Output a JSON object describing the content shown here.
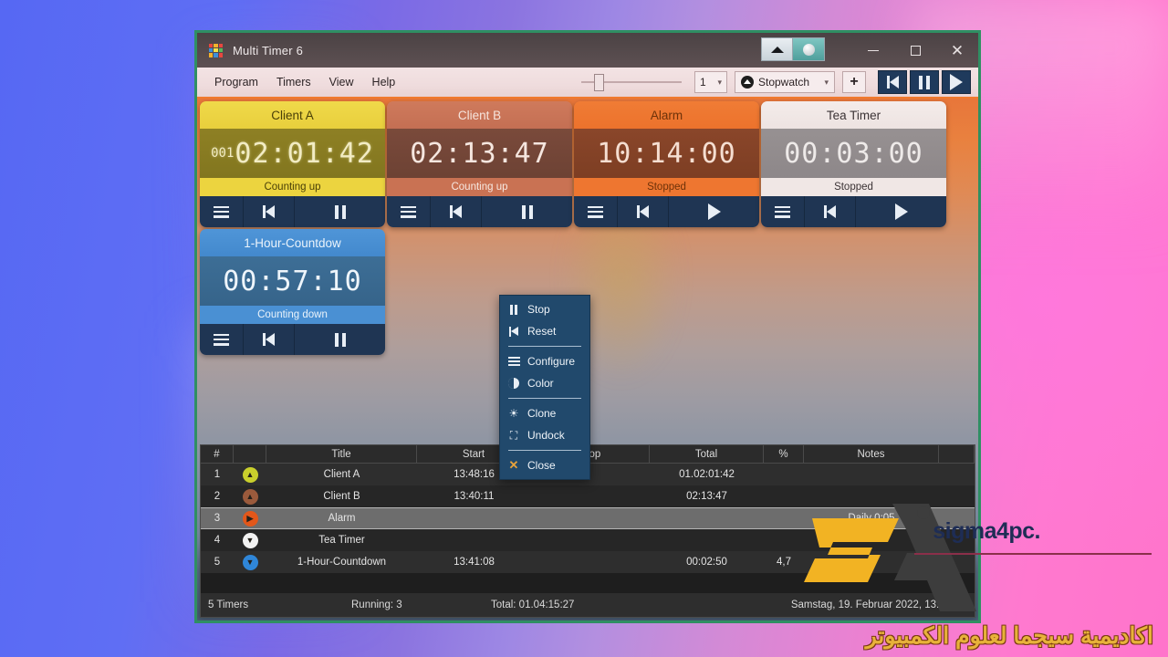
{
  "window": {
    "title": "Multi Timer 6",
    "app_icon": "grid-icon",
    "controls": {
      "minimize": "–",
      "maximize": "□",
      "close": "✕"
    }
  },
  "menubar": {
    "items": [
      {
        "label": "Program"
      },
      {
        "label": "Timers"
      },
      {
        "label": "View"
      },
      {
        "label": "Help"
      }
    ]
  },
  "toolbar": {
    "count_value": "1",
    "mode_value": "Stopwatch",
    "add_label": "+",
    "nav": [
      {
        "name": "skip-back-button",
        "glyph": "prev"
      },
      {
        "name": "pause-all-button",
        "glyph": "pause"
      },
      {
        "name": "play-all-button",
        "glyph": "play"
      }
    ]
  },
  "timers": [
    {
      "title": "Client A",
      "days": "001",
      "time": "02:01:42",
      "status": "Counting up",
      "theme": "c-yellow",
      "buttons": [
        "menu",
        "reset",
        "pause"
      ]
    },
    {
      "title": "Client B",
      "days": "",
      "time": "02:13:47",
      "status": "Counting up",
      "theme": "c-brown",
      "buttons": [
        "menu",
        "reset",
        "pause"
      ]
    },
    {
      "title": "Alarm",
      "days": "",
      "time": "10:14:00",
      "status": "Stopped",
      "theme": "c-orange",
      "buttons": [
        "menu",
        "reset",
        "play"
      ]
    },
    {
      "title": "Tea Timer",
      "days": "",
      "time": "00:03:00",
      "status": "Stopped",
      "theme": "c-white",
      "buttons": [
        "menu",
        "reset",
        "play"
      ]
    },
    {
      "title": "1-Hour-Countdow",
      "days": "",
      "time": "00:57:10",
      "status": "Counting down",
      "theme": "c-blue",
      "buttons": [
        "menu",
        "reset",
        "pause"
      ]
    }
  ],
  "context_menu": {
    "items": [
      {
        "label": "Stop",
        "icon": "pause-icon"
      },
      {
        "label": "Reset",
        "icon": "skip-back-icon"
      },
      {
        "separator": true
      },
      {
        "label": "Configure",
        "icon": "menu-lines-icon"
      },
      {
        "label": "Color",
        "icon": "contrast-icon"
      },
      {
        "separator": true
      },
      {
        "label": "Clone",
        "icon": "clone-icon"
      },
      {
        "label": "Undock",
        "icon": "undock-icon"
      },
      {
        "separator": true
      },
      {
        "label": "Close",
        "icon": "close-x-icon"
      }
    ]
  },
  "table": {
    "columns": [
      "#",
      "",
      "Title",
      "Start",
      "Stop",
      "Total",
      "%",
      "Notes",
      ""
    ],
    "rows": [
      {
        "num": "1",
        "state": "up",
        "state_color": "#c9cf2c",
        "title": "Client A",
        "start": "13:48:16",
        "stop": "",
        "total": "01.02:01:42",
        "pct": "",
        "notes": "",
        "selected": false
      },
      {
        "num": "2",
        "state": "up",
        "state_color": "#9a5a3c",
        "title": "Client B",
        "start": "13:40:11",
        "stop": "",
        "total": "02:13:47",
        "pct": "",
        "notes": "",
        "selected": false
      },
      {
        "num": "3",
        "state": "right",
        "state_color": "#e2571a",
        "title": "Alarm",
        "start": "",
        "stop": "",
        "total": "",
        "pct": "",
        "notes": "Daily  0:05",
        "selected": true
      },
      {
        "num": "4",
        "state": "down",
        "state_color": "#f2f2f2",
        "title": "Tea Timer",
        "start": "",
        "stop": "",
        "total": "",
        "pct": "",
        "notes": "",
        "selected": false
      },
      {
        "num": "5",
        "state": "down",
        "state_color": "#2f86d8",
        "title": "1-Hour-Countdown",
        "start": "13:41:08",
        "stop": "",
        "total": "00:02:50",
        "pct": "4,7",
        "notes": "",
        "selected": false
      }
    ]
  },
  "statusbar": {
    "timers": "5 Timers",
    "running": "Running: 3",
    "total": "Total: 01.04:15:27",
    "datetime": "Samstag, 19. Februar 2022, 13:43:58"
  },
  "watermark": {
    "site": "sigma4pc.",
    "arabic": "اكاديمية سيجما لعلوم الكمبيوتر"
  },
  "colors": {
    "accent_orange": "#f07a2e",
    "capture_border": "#2f8f63",
    "button_navy": "#1f3a5c"
  }
}
